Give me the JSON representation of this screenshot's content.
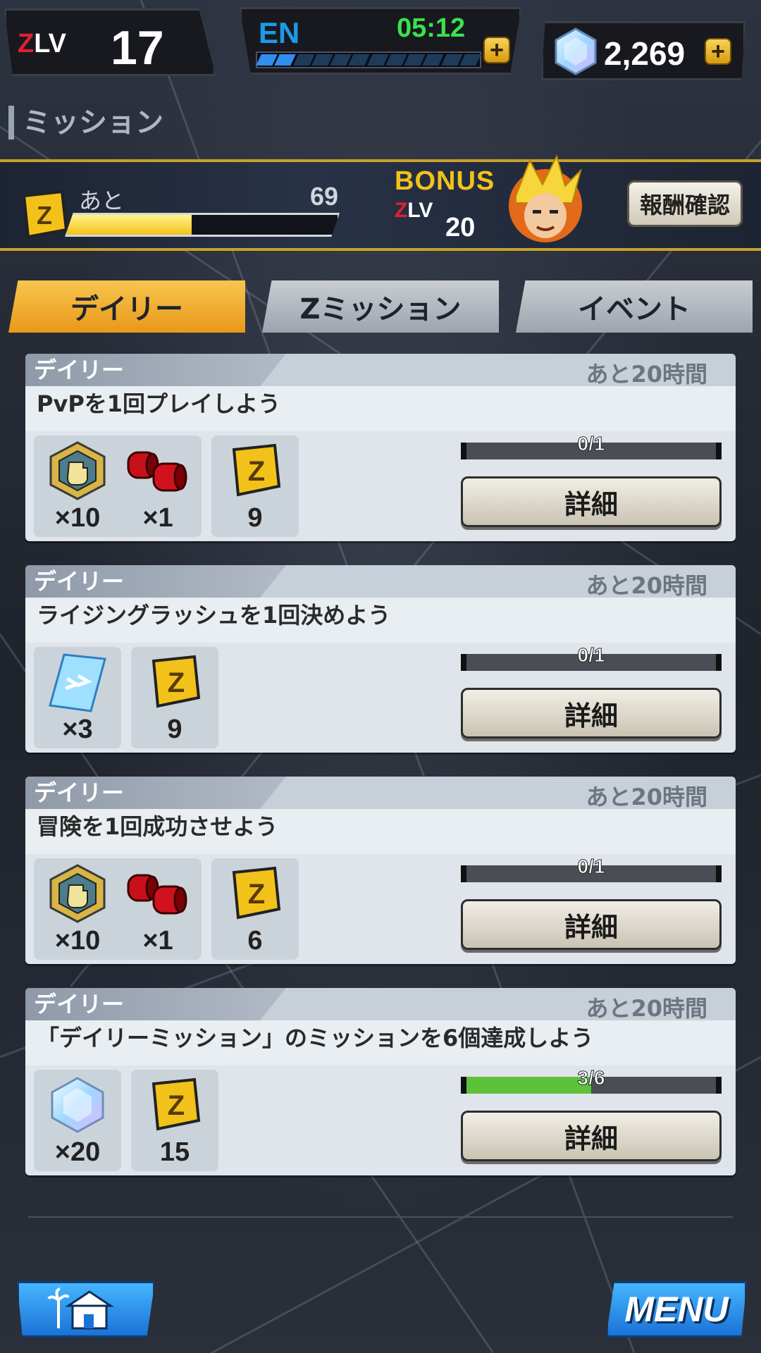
{
  "hud": {
    "zlv_label_z": "Z",
    "zlv_label_lv": "LV",
    "zlv_value": "17",
    "en_label": "EN",
    "en_timer": "05:12",
    "en_segments": 12,
    "en_filled": 2,
    "gems": "2,269"
  },
  "page": {
    "title": "ミッション"
  },
  "bonus": {
    "ato_label": "あと",
    "remaining": "69",
    "progress_fraction": 0.46,
    "bonus_label": "BONUS",
    "zlv_label_z": "Z",
    "zlv_label_lv": "LV",
    "target_zlv": "20",
    "reward_button": "報酬確認"
  },
  "tabs": [
    {
      "label": "デイリー",
      "active": true
    },
    {
      "label": "Zミッション",
      "active": false
    },
    {
      "label": "イベント",
      "active": false
    }
  ],
  "missions": [
    {
      "category": "デイリー",
      "time_left": "あと20時間",
      "title": "PvPを1回プレイしよう",
      "reward_groups": [
        [
          {
            "icon": "fist-medal-icon",
            "qty": "×10"
          },
          {
            "icon": "red-capsule-icon",
            "qty": "×1"
          }
        ],
        [
          {
            "icon": "z-ticket-icon",
            "qty": "9"
          }
        ]
      ],
      "progress_text": "0/1",
      "progress_fraction": 0,
      "detail_label": "詳細"
    },
    {
      "category": "デイリー",
      "time_left": "あと20時間",
      "title": "ライジングラッシュを1回決めよう",
      "reward_groups": [
        [
          {
            "icon": "blue-ticket-icon",
            "qty": "×3"
          }
        ],
        [
          {
            "icon": "z-ticket-icon",
            "qty": "9"
          }
        ]
      ],
      "progress_text": "0/1",
      "progress_fraction": 0,
      "detail_label": "詳細"
    },
    {
      "category": "デイリー",
      "time_left": "あと20時間",
      "title": "冒険を1回成功させよう",
      "reward_groups": [
        [
          {
            "icon": "fist-medal-icon",
            "qty": "×10"
          },
          {
            "icon": "red-capsule-icon",
            "qty": "×1"
          }
        ],
        [
          {
            "icon": "z-ticket-icon",
            "qty": "6"
          }
        ]
      ],
      "progress_text": "0/1",
      "progress_fraction": 0,
      "detail_label": "詳細"
    },
    {
      "category": "デイリー",
      "time_left": "あと20時間",
      "title": "「デイリーミッション」のミッションを6個達成しよう",
      "reward_groups": [
        [
          {
            "icon": "chrono-crystal-icon",
            "qty": "×20"
          }
        ],
        [
          {
            "icon": "z-ticket-icon",
            "qty": "15"
          }
        ]
      ],
      "progress_text": "3/6",
      "progress_fraction": 0.5,
      "detail_label": "詳細"
    }
  ],
  "bottom": {
    "home_icon": "home-icon",
    "menu_label": "MENU"
  },
  "colors": {
    "accent_gold": "#f2c21a",
    "tab_active": "#e9981a",
    "progress_green": "#5cc23a",
    "button_blue": "#1b72d6"
  }
}
